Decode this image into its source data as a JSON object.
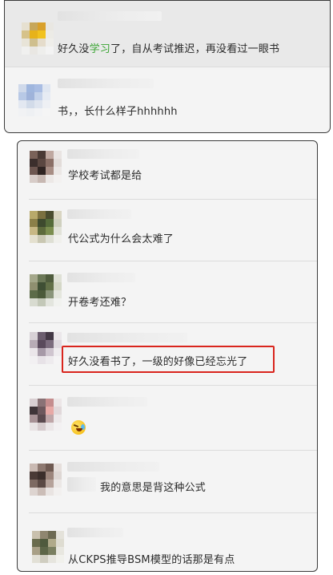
{
  "top_panel": {
    "messages": [
      {
        "text_before": "好久没",
        "text_highlight": "学习",
        "text_after": "了，自从考试推迟，再没看过一眼书",
        "avatar_colors": [
          "#e6e0d0",
          "#c7a75a",
          "#d9a02a",
          "#e9e7e2",
          "#d6c28a",
          "#e7b21a",
          "#f1c21e",
          "#ecebe6",
          "#e8e4d8",
          "#cfbf8e",
          "#e5dccb",
          "#efeeea",
          "#f0f0ef",
          "#e9e7e3",
          "#eeeeec",
          "#f3f3f3"
        ]
      },
      {
        "text": "书，，长什么样子hhhhhh",
        "avatar_colors": [
          "#cfd9ea",
          "#9fb6de",
          "#a9bde3",
          "#dfe6f1",
          "#b8c9e6",
          "#9fb3da",
          "#c4d2ea",
          "#e6ebf3",
          "#e3e8f1",
          "#d2dbe9",
          "#dfe5ef",
          "#eef0f4",
          "#f1f2f4",
          "#eef0f3",
          "#f2f3f5",
          "#f5f5f5"
        ]
      }
    ]
  },
  "bottom_panel": {
    "messages": [
      {
        "text": "学校考试都是给",
        "avatar_colors": [
          "#7a6259",
          "#4a3a35",
          "#bfa8a0",
          "#e9e4e2",
          "#3b2e2c",
          "#5b4741",
          "#8a6f66",
          "#e2dcd9",
          "#6d5650",
          "#2f2422",
          "#a78d84",
          "#ebe7e5",
          "#d7ccc8",
          "#c7b8b2",
          "#ece8e6",
          "#f3f1f0"
        ]
      },
      {
        "text": "代公式为什么会太难了",
        "avatar_colors": [
          "#b8a96a",
          "#7b7040",
          "#4a4c2f",
          "#d9d5c2",
          "#8b7f48",
          "#3e4a2e",
          "#556b3a",
          "#cfd0bf",
          "#c7b784",
          "#5d6a3c",
          "#7b8d4f",
          "#e1e2d8",
          "#e4e0cf",
          "#c9c7b2",
          "#dedfd4",
          "#f0f0ec"
        ]
      },
      {
        "text": "开卷考还难？",
        "avatar_colors": [
          "#a4a78a",
          "#6b7857",
          "#4f5c3d",
          "#dfe1d6",
          "#8f8f70",
          "#3f4f34",
          "#627048",
          "#d5d8c8",
          "#5c6b48",
          "#4b5a3a",
          "#8a957a",
          "#e4e6dd",
          "#d8dbd0",
          "#c3c8b8",
          "#e3e5de",
          "#f1f2ef"
        ]
      },
      {
        "text": "好久没看书了，一级的好像已经忘光了",
        "highlighted": true,
        "avatar_colors": [
          "#d7d1d6",
          "#6b5d6e",
          "#433845",
          "#ebe7ea",
          "#b8acb6",
          "#5a4a5c",
          "#7c6c7e",
          "#e0dae0",
          "#ebe6ea",
          "#a699a7",
          "#cfc5cf",
          "#efecef",
          "#f2f0f2",
          "#e7e2e7",
          "#eeebee",
          "#f5f4f5"
        ]
      },
      {
        "emoji": "crying-laughing-emoji",
        "avatar_colors": [
          "#d9cfd2",
          "#8a7276",
          "#c58d8e",
          "#ece6e7",
          "#3f3438",
          "#6d585d",
          "#e7a9a6",
          "#e1d8da",
          "#a89296",
          "#5b4a4f",
          "#bfa6a8",
          "#ece8e9",
          "#e8e3e4",
          "#d6cbcd",
          "#ebe6e7",
          "#f3f1f2"
        ]
      },
      {
        "text": "我的意思是背这种公式",
        "avatar_colors": [
          "#c9b9b2",
          "#8d7870",
          "#6f5a52",
          "#e6dfdc",
          "#4a3a36",
          "#3b2e2b",
          "#9c857c",
          "#ded7d4",
          "#7d6a62",
          "#5a4944",
          "#b5a29a",
          "#ebe7e5",
          "#ddd4d0",
          "#cbbdb7",
          "#e9e4e2",
          "#f2f0ef"
        ]
      },
      {
        "text": "从CKPS推导BSM模型的话那是有点",
        "avatar_colors": [
          "#c9c0ad",
          "#8f8670",
          "#6d6a52",
          "#e4e2da",
          "#6a6c4e",
          "#4f5a3d",
          "#b0aa8a",
          "#dedcd1",
          "#a9a087",
          "#5d6648",
          "#7a7f60",
          "#e8e7e0",
          "#e2e0d6",
          "#cfcdc0",
          "#e6e5de",
          "#f1f1ec"
        ]
      }
    ]
  }
}
